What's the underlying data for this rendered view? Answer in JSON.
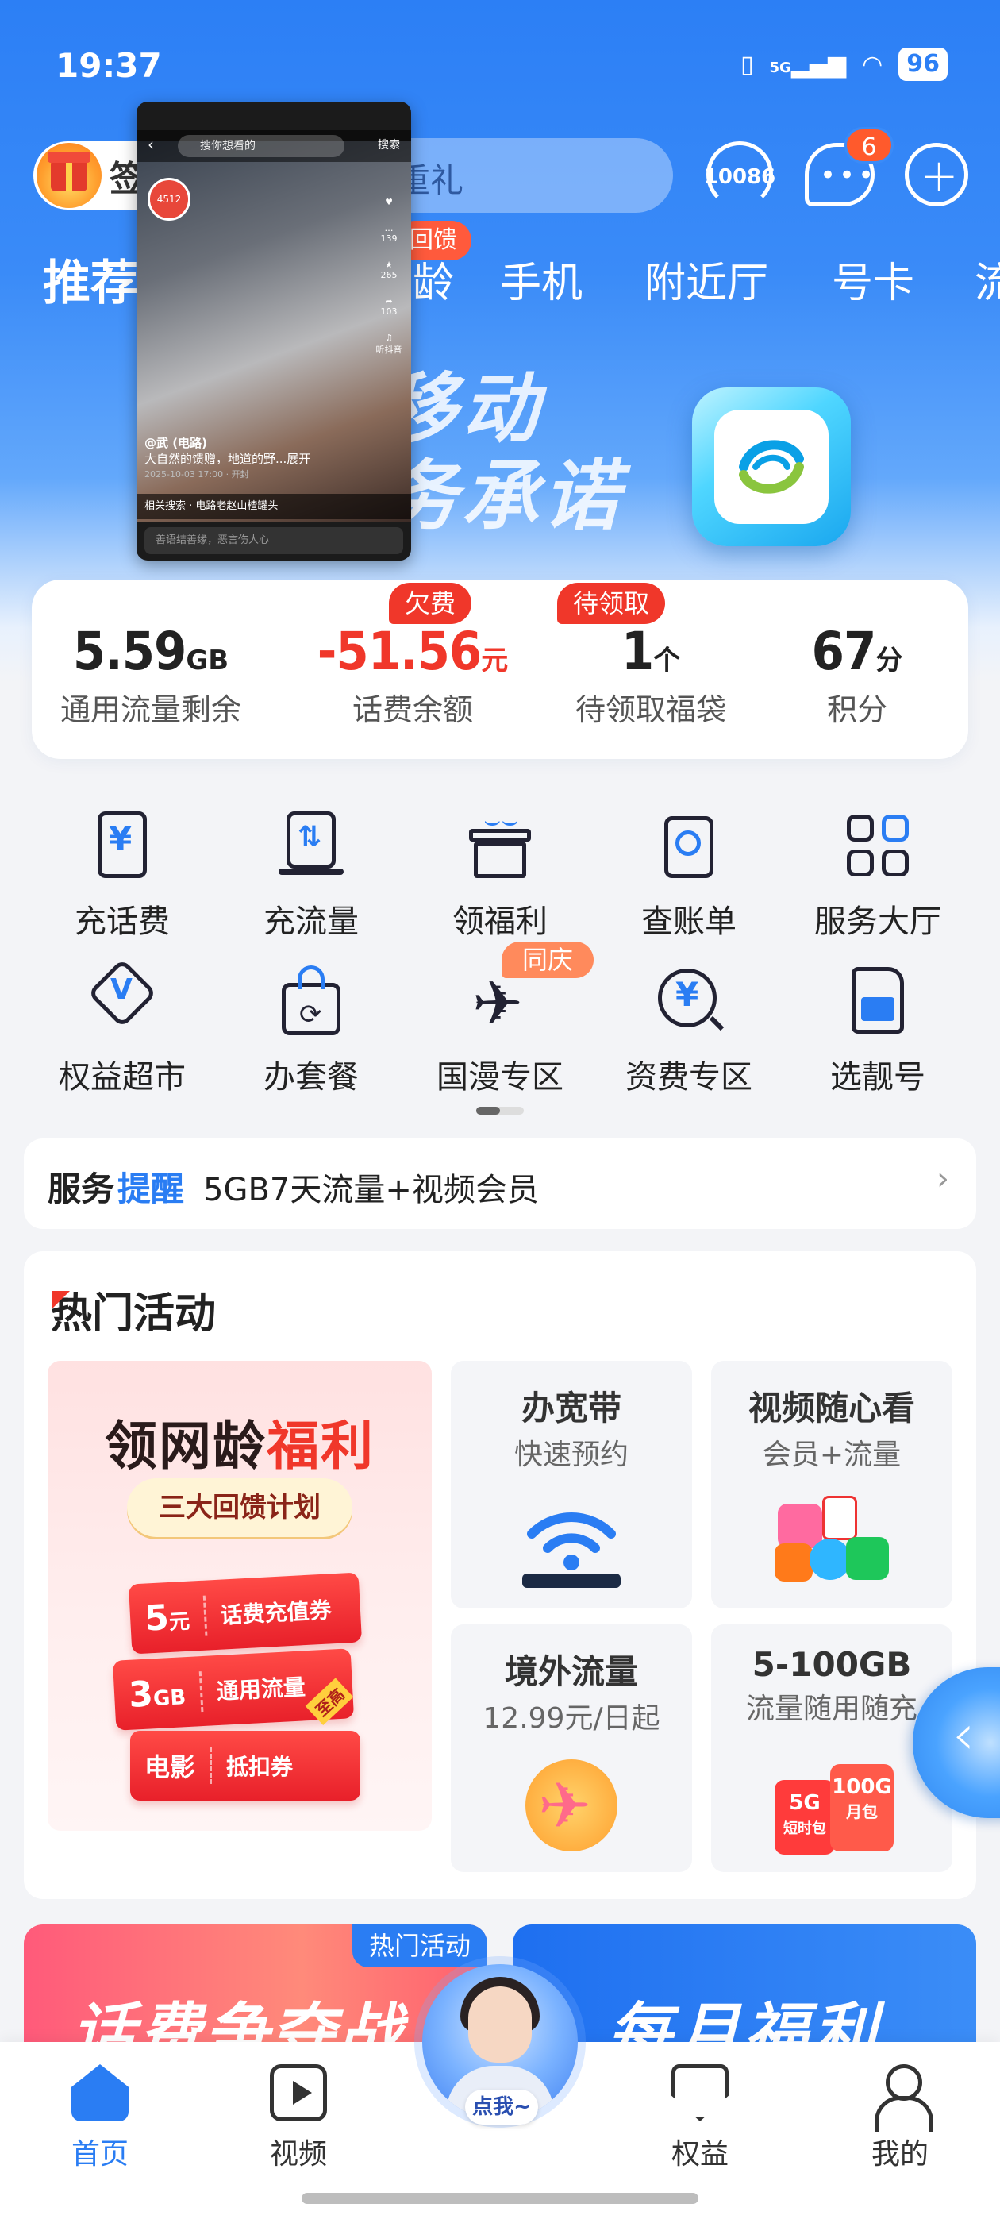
{
  "status_bar": {
    "time": "19:37",
    "network": "5G",
    "battery": "96"
  },
  "header": {
    "checkin_label": "签",
    "search_placeholder": "重礼",
    "hotline": "10086",
    "message_badge": "6"
  },
  "tabs": [
    {
      "label": "推荐"
    },
    {
      "label": "龄"
    },
    {
      "label": "手机"
    },
    {
      "label": "附近厅"
    },
    {
      "label": "号卡"
    },
    {
      "label": "流"
    }
  ],
  "tab_badge": "回馈",
  "banner": {
    "line1": "移动",
    "line2": "务承诺"
  },
  "pip_video": {
    "search_hint": "搜你想看的",
    "search_button": "搜索",
    "author": "@武 (电路)",
    "caption": "大自然的馈赠，地道的野...展开",
    "date": "2025-10-03 17:00 · 开封",
    "related": "相关搜索 · 电路老赵山楂罐头",
    "comment_hint": "善语结善缘，恶言伤人心",
    "counts": {
      "comments": "139",
      "stars": "265",
      "shares": "103"
    },
    "music": "听抖音",
    "avatar_count": "4512"
  },
  "stats": [
    {
      "value": "5.59",
      "unit": "GB",
      "label": "通用流量剩余",
      "badge": ""
    },
    {
      "value": "-51.56",
      "unit": "元",
      "label": "话费余额",
      "badge": "欠费"
    },
    {
      "value": "1",
      "unit": "个",
      "label": "待领取福袋",
      "badge": "待领取"
    },
    {
      "value": "67",
      "unit": "分",
      "label": "积分",
      "badge": ""
    }
  ],
  "grid": [
    {
      "label": "充话费",
      "icon": "phone-recharge-icon"
    },
    {
      "label": "充流量",
      "icon": "data-recharge-icon"
    },
    {
      "label": "领福利",
      "icon": "gift-icon"
    },
    {
      "label": "查账单",
      "icon": "bill-search-icon"
    },
    {
      "label": "服务大厅",
      "icon": "service-grid-icon"
    },
    {
      "label": "权益超市",
      "icon": "rights-badge-icon"
    },
    {
      "label": "办套餐",
      "icon": "package-bag-icon"
    },
    {
      "label": "国漫专区",
      "icon": "airplane-icon"
    },
    {
      "label": "资费专区",
      "icon": "tariff-search-icon"
    },
    {
      "label": "选靓号",
      "icon": "sim-card-icon"
    }
  ],
  "grid_badge": "同庆",
  "reminder": {
    "title_a": "服务",
    "title_b": "提醒",
    "text": "5GB7天流量+视频会员"
  },
  "hot": {
    "title": "热门活动",
    "big": {
      "heading_a": "领网龄",
      "heading_b": "福利",
      "pill": "三大回馈计划",
      "coupons": [
        {
          "amount": "5",
          "unit": "元",
          "desc": "话费充值券"
        },
        {
          "amount": "3",
          "unit": "GB",
          "desc": "通用流量",
          "tag": "至高"
        },
        {
          "amount": "电影",
          "unit": "",
          "desc": "抵扣券"
        }
      ]
    },
    "small": [
      {
        "title": "办宽带",
        "sub": "快速预约",
        "icon": "wifi-router-icon"
      },
      {
        "title": "视频随心看",
        "sub": "会员+流量",
        "icon": "video-apps-icon"
      },
      {
        "title": "境外流量",
        "sub": "12.99元/日起",
        "icon": "plane-badge-icon"
      },
      {
        "title": "5-100GB",
        "sub": "流量随用随充",
        "icon": "data-pack-icon"
      }
    ],
    "mini_labels": {
      "a": "5G",
      "b": "短时包",
      "c": "100G",
      "d": "月包"
    }
  },
  "bottom_banners": {
    "left": "话费争夺战",
    "left_tag": "热门活动",
    "right": "每月福利"
  },
  "tabbar": [
    {
      "label": "首页"
    },
    {
      "label": "视频"
    },
    {
      "label": "权益"
    },
    {
      "label": "我的"
    }
  ],
  "assistant": "点我~",
  "colors": {
    "primary": "#2a7df3",
    "alert": "#f0372a",
    "header": "#2c7ff5"
  }
}
